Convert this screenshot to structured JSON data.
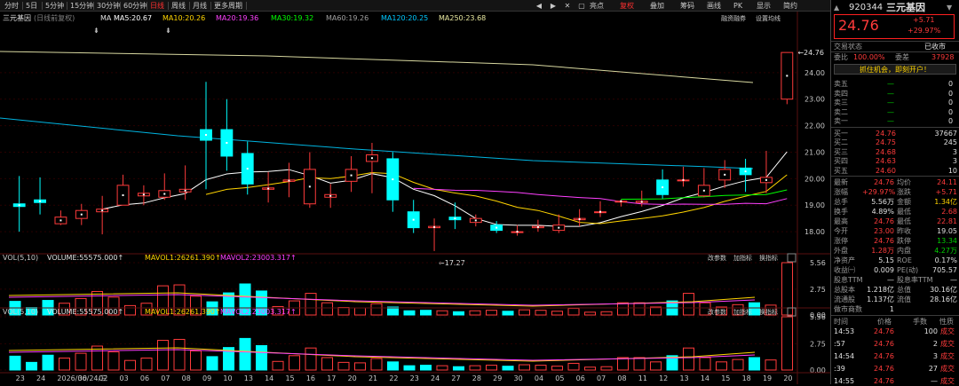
{
  "toolbar": {
    "buttons": [
      "分时",
      "5日",
      "5分钟",
      "15分钟",
      "30分钟",
      "60分钟",
      "日线",
      "周线",
      "月线",
      "更多周期"
    ],
    "active": "日线",
    "right_buttons": [
      "亮点",
      "复权",
      "叠加",
      "筹码",
      "画线",
      "PK",
      "显示",
      "简约"
    ],
    "right_active": "复权"
  },
  "chart_header": {
    "title": "三元基因",
    "subtitle": "(日线前复权)",
    "ma_label": "MA",
    "ma": [
      {
        "text": "MA5:20.67",
        "color": "#ffffff"
      },
      {
        "text": "MA10:20.26",
        "color": "#ffd400"
      },
      {
        "text": "MA20:19.36",
        "color": "#ff40ff"
      },
      {
        "text": "MA30:19.32",
        "color": "#00ff00"
      },
      {
        "text": "MA60:19.26",
        "color": "#a0a0a0"
      },
      {
        "text": "MA120:20.25",
        "color": "#00c8ff"
      },
      {
        "text": "MA250:23.68",
        "color": "#e8e8a0"
      }
    ],
    "right_labels": [
      "融资融券",
      "设置均线"
    ],
    "max_label": "24.76",
    "min_label": "17.27"
  },
  "chart_data": [
    {
      "type": "candlestick",
      "title": "三元基因(日线前复权)",
      "ylim": [
        17.2,
        25.3
      ],
      "y_ticks": [
        18.0,
        19.0,
        20.0,
        21.0,
        22.0,
        23.0,
        24.0
      ],
      "x_labels": [
        "23",
        "24",
        "2026/06/24/三",
        "30",
        "02",
        "03",
        "06",
        "07",
        "08",
        "09",
        "10",
        "13",
        "14",
        "15",
        "16",
        "17",
        "20",
        "21",
        "22",
        "23",
        "24",
        "27",
        "28",
        "29",
        "30",
        "04",
        "05",
        "06",
        "07",
        "08",
        "11",
        "12",
        "13",
        "14",
        "15",
        "18",
        "19",
        "20"
      ],
      "candles": [
        [
          19.05,
          18.95,
          20.1,
          18.0
        ],
        [
          19.2,
          19.1,
          20.05,
          18.65
        ],
        [
          18.3,
          18.55,
          18.8,
          18.25
        ],
        [
          18.5,
          18.8,
          19.05,
          18.25
        ],
        [
          18.75,
          18.85,
          19.35,
          17.9
        ],
        [
          19.0,
          19.75,
          20.15,
          19.0
        ],
        [
          19.35,
          19.45,
          19.75,
          19.0
        ],
        [
          19.3,
          19.55,
          20.2,
          19.2
        ],
        [
          19.5,
          19.6,
          20.5,
          19.2
        ],
        [
          21.85,
          21.45,
          23.65,
          19.6
        ],
        [
          21.85,
          20.85,
          23.0,
          20.3
        ],
        [
          20.95,
          19.8,
          21.4,
          19.4
        ],
        [
          19.6,
          19.65,
          20.25,
          19.1
        ],
        [
          19.9,
          19.95,
          20.6,
          19.3
        ],
        [
          19.05,
          20.35,
          21.0,
          18.9
        ],
        [
          19.3,
          19.4,
          19.8,
          18.9
        ],
        [
          19.9,
          20.35,
          20.85,
          19.5
        ],
        [
          20.65,
          20.9,
          21.35,
          19.45
        ],
        [
          20.75,
          19.2,
          21.0,
          18.75
        ],
        [
          18.75,
          18.15,
          19.2,
          17.95
        ],
        [
          18.15,
          18.2,
          18.5,
          17.27
        ],
        [
          18.55,
          18.45,
          19.1,
          18.1
        ],
        [
          18.35,
          18.5,
          18.65,
          18.2
        ],
        [
          18.25,
          18.05,
          18.4,
          17.95
        ],
        [
          18.0,
          18.0,
          18.25,
          17.85
        ],
        [
          18.15,
          18.2,
          18.45,
          18.0
        ],
        [
          18.05,
          18.25,
          18.65,
          17.95
        ],
        [
          18.45,
          18.5,
          18.85,
          18.2
        ],
        [
          18.75,
          18.75,
          19.15,
          18.55
        ],
        [
          19.15,
          19.15,
          19.2,
          18.95
        ],
        [
          19.1,
          19.15,
          19.55,
          18.95
        ],
        [
          19.95,
          19.4,
          20.35,
          19.25
        ],
        [
          19.95,
          19.95,
          20.45,
          19.7
        ],
        [
          19.35,
          19.75,
          20.4,
          19.3
        ],
        [
          19.95,
          20.35,
          20.7,
          19.65
        ],
        [
          20.4,
          20.15,
          20.75,
          19.5
        ],
        [
          19.85,
          20.05,
          21.05,
          19.45
        ],
        [
          23.0,
          24.76,
          24.76,
          22.81
        ]
      ]
    },
    {
      "type": "bar",
      "title": "VOL(5,10)",
      "series_labels": [
        "VOL(5,10)",
        "VOLUME:55575.000↑",
        "MAVOL1:26261.390↑",
        "MAVOL2:23003.317↑"
      ],
      "y_ticks": [
        0.0,
        2.75,
        5.56
      ],
      "tool_labels": [
        "改参数",
        "加指标",
        "换指标"
      ],
      "values": [
        1.45,
        0.8,
        1.55,
        1.25,
        1.75,
        2.5,
        1.9,
        1.0,
        1.25,
        3.1,
        3.2,
        2.0,
        1.4,
        2.35,
        3.3,
        2.55,
        0.9,
        1.5,
        2.3,
        1.3,
        0.8,
        0.75,
        1.2,
        0.85,
        0.45,
        0.5,
        0.45,
        0.35,
        0.45,
        0.5,
        0.4,
        0.55,
        0.5,
        0.4,
        0.7,
        0.3,
        0.35,
        1.3,
        1.3,
        0.85,
        1.5,
        2.3,
        1.3,
        0.85,
        1.1,
        1.3,
        1.05,
        5.56
      ]
    },
    {
      "type": "bar",
      "title": "VOL(5,10)",
      "series_labels": [
        "VOL(5,10)",
        "VOLUME:55575.000↑",
        "MAVOL1:26261.390↑",
        "MAVOL2:23003.317↑"
      ],
      "y_ticks": [
        0.0,
        2.75,
        5.56
      ],
      "tool_labels": [
        "改参数",
        "加指标",
        "换指标"
      ],
      "values": [
        1.45,
        0.8,
        1.55,
        1.25,
        1.75,
        2.5,
        1.9,
        1.0,
        1.25,
        3.1,
        3.2,
        2.0,
        1.4,
        2.35,
        3.3,
        2.55,
        0.9,
        1.5,
        2.3,
        1.3,
        0.8,
        0.75,
        1.2,
        0.85,
        0.45,
        0.5,
        0.45,
        0.35,
        0.45,
        0.5,
        0.4,
        0.55,
        0.5,
        0.4,
        0.7,
        0.3,
        0.35,
        1.3,
        1.3,
        0.85,
        1.5,
        2.3,
        1.3,
        0.85,
        1.1,
        1.3,
        1.05,
        5.56
      ]
    }
  ],
  "right": {
    "code": "920344",
    "name": "三元基因",
    "price": "24.76",
    "change": "+5.71",
    "pct": "+29.97%",
    "status_label": "交易状态",
    "status_value": "已收市",
    "wb_label": "委比",
    "wb_value": "100.00%",
    "wc_label": "委差",
    "wc_value": "37928",
    "promo": "抓住机会，即刻开户！",
    "sells": [
      {
        "label": "卖五",
        "price": "—",
        "vol": "0"
      },
      {
        "label": "卖四",
        "price": "—",
        "vol": "0"
      },
      {
        "label": "卖三",
        "price": "—",
        "vol": "0"
      },
      {
        "label": "卖二",
        "price": "—",
        "vol": "0"
      },
      {
        "label": "卖一",
        "price": "—",
        "vol": "0"
      }
    ],
    "buys": [
      {
        "label": "买一",
        "price": "24.76",
        "vol": "37667"
      },
      {
        "label": "买二",
        "price": "24.75",
        "vol": "245"
      },
      {
        "label": "买三",
        "price": "24.68",
        "vol": "3"
      },
      {
        "label": "买四",
        "price": "24.63",
        "vol": "3"
      },
      {
        "label": "买五",
        "price": "24.60",
        "vol": "10"
      }
    ],
    "stats": [
      [
        {
          "l": "最新",
          "v": "24.76",
          "c": "red"
        },
        {
          "l": "均价",
          "v": "24.11",
          "c": "red"
        }
      ],
      [
        {
          "l": "涨幅",
          "v": "+29.97%",
          "c": "red"
        },
        {
          "l": "涨跌",
          "v": "+5.71",
          "c": "red"
        }
      ],
      [
        {
          "l": "总手",
          "v": "5.56万",
          "c": "white"
        },
        {
          "l": "金额",
          "v": "1.34亿",
          "c": "yellow"
        }
      ],
      [
        {
          "l": "换手",
          "v": "4.89%",
          "c": "white"
        },
        {
          "l": "最低",
          "v": "2.68",
          "c": "red"
        }
      ],
      [
        {
          "l": "最高",
          "v": "24.76",
          "c": "red"
        },
        {
          "l": "最低",
          "v": "22.81",
          "c": "red"
        }
      ],
      [
        {
          "l": "今开",
          "v": "23.00",
          "c": "red"
        },
        {
          "l": "昨收",
          "v": "19.05",
          "c": "white"
        }
      ],
      [
        {
          "l": "涨停",
          "v": "24.76",
          "c": "red"
        },
        {
          "l": "跌停",
          "v": "13.34",
          "c": "green"
        }
      ],
      [
        {
          "l": "外盘",
          "v": "1.28万",
          "c": "red"
        },
        {
          "l": "内盘",
          "v": "4.27万",
          "c": "green"
        }
      ],
      [
        {
          "l": "净资产",
          "v": "5.15",
          "c": "white"
        },
        {
          "l": "ROE",
          "v": "0.17%",
          "c": "white"
        }
      ],
      [
        {
          "l": "收益㈠",
          "v": "0.009",
          "c": "white"
        },
        {
          "l": "PE(动)",
          "v": "705.57",
          "c": "white"
        }
      ],
      [
        {
          "l": "股息TTM",
          "v": "—",
          "c": "white"
        },
        {
          "l": "股息率TTM",
          "v": "—",
          "c": "white"
        }
      ],
      [
        {
          "l": "总股本",
          "v": "1.218亿",
          "c": "white"
        },
        {
          "l": "总值",
          "v": "30.16亿",
          "c": "white"
        }
      ],
      [
        {
          "l": "流通股",
          "v": "1.137亿",
          "c": "white"
        },
        {
          "l": "流值",
          "v": "28.16亿",
          "c": "white"
        }
      ],
      [
        {
          "l": "做市商数",
          "v": "1",
          "c": "white"
        }
      ]
    ],
    "ticks_header": [
      "时间",
      "价格",
      "手数",
      "性质"
    ],
    "ticks": [
      {
        "t": "14:53",
        "p": "24.76",
        "n": "100",
        "k": "成交"
      },
      {
        "t": ":57",
        "p": "24.76",
        "n": "2",
        "k": "成交"
      },
      {
        "t": "14:54",
        "p": "24.76",
        "n": "3",
        "k": "成交"
      },
      {
        "t": ":39",
        "p": "24.76",
        "n": "27",
        "k": "成交"
      },
      {
        "t": "14:55",
        "p": "24.76",
        "n": "—",
        "k": "成交"
      }
    ]
  }
}
